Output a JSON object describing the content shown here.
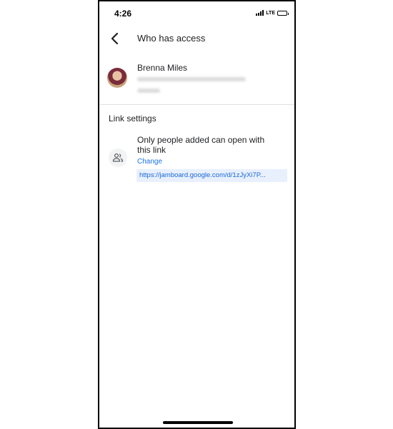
{
  "status_bar": {
    "time": "4:26",
    "network": "LTE",
    "icons": [
      "signal-icon",
      "battery-icon"
    ],
    "battery_level": 0.5
  },
  "header": {
    "title": "Who has access",
    "back_icon": "chevron-left-icon"
  },
  "person": {
    "name": "Brenna Miles",
    "avatar_icon": "avatar"
  },
  "link_settings": {
    "heading": "Link settings",
    "icon": "people-icon",
    "access_text": "Only people added can open with this link",
    "change_label": "Change",
    "url": "https://jamboard.google.com/d/1zJyXi7P..."
  },
  "colors": {
    "accent": "#1a73e8",
    "chip_background": "#e8f0fe",
    "divider": "#e0e0e0"
  }
}
